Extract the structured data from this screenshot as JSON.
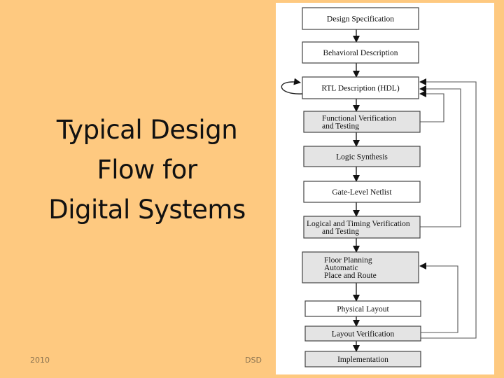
{
  "slide": {
    "title_lines": [
      "Typical Design",
      "Flow for",
      "Digital Systems"
    ],
    "footer_left": "2010",
    "footer_center": "DSD",
    "background_color": "#fec980"
  },
  "diagram": {
    "type": "flowchart",
    "steps": [
      {
        "id": "design-spec",
        "lines": [
          "Design Specification"
        ],
        "shaded": false
      },
      {
        "id": "behavioral",
        "lines": [
          "Behavioral Description"
        ],
        "shaded": false
      },
      {
        "id": "rtl",
        "lines": [
          "RTL Description (HDL)"
        ],
        "shaded": false
      },
      {
        "id": "functional-verification",
        "lines": [
          "Functional Verification",
          "and Testing"
        ],
        "shaded": true
      },
      {
        "id": "logic-synthesis",
        "lines": [
          "Logic Synthesis"
        ],
        "shaded": true
      },
      {
        "id": "gate-level-netlist",
        "lines": [
          "Gate-Level Netlist"
        ],
        "shaded": false
      },
      {
        "id": "logical-timing-verification",
        "lines": [
          "Logical and Timing Verification",
          "and Testing"
        ],
        "shaded": true
      },
      {
        "id": "floor-planning",
        "lines": [
          "Floor Planning",
          "Automatic",
          "Place and Route"
        ],
        "shaded": true
      },
      {
        "id": "physical-layout",
        "lines": [
          "Physical Layout"
        ],
        "shaded": false
      },
      {
        "id": "layout-verification",
        "lines": [
          "Layout Verification"
        ],
        "shaded": true
      },
      {
        "id": "implementation",
        "lines": [
          "Implementation"
        ],
        "shaded": true
      }
    ],
    "feedback": [
      {
        "from": "rtl",
        "to": "rtl",
        "kind": "self-loop"
      },
      {
        "from": "functional-verification",
        "to": "rtl"
      },
      {
        "from": "logical-timing-verification",
        "to": "rtl"
      },
      {
        "from": "layout-verification",
        "to": "rtl"
      },
      {
        "from": "layout-verification",
        "to": "floor-planning"
      }
    ],
    "colors": {
      "shaded_fill": "#e4e4e4",
      "plain_fill": "#ffffff",
      "stroke": "#444444"
    }
  }
}
